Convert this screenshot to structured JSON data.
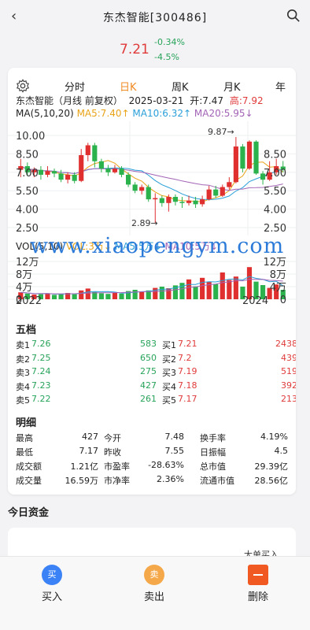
{
  "header": {
    "title": "东杰智能[300486]",
    "back_icon": "‹"
  },
  "quote": {
    "price": "7.21",
    "change": "-0.34%",
    "change_pct": "-4.5%"
  },
  "chart": {
    "tabs": [
      "分时",
      "日K",
      "周K",
      "月K",
      "年"
    ],
    "active_tab": "日K",
    "info": {
      "name": "东杰智能（月线 前复权）",
      "date": "2025-03-21",
      "open": "开:7.47",
      "high": "高:7.92"
    },
    "ma_legend": {
      "prefix": "MA(5,10,20)",
      "ma5": "MA5:7.40↑",
      "ma10": "MA10:6.32↑",
      "ma20": "MA20:5.95↓"
    },
    "vol_legend": {
      "prefix": "VOL(5,10)",
      "vol": "VOL:3万↓",
      "ma5": "MA5:5万↓",
      "ma10": "MA10:5万↓"
    },
    "price_ticks": [
      "10.00",
      "8.50",
      "7.00",
      "5.50",
      "4.00",
      "2.50"
    ],
    "price_ticks_right": [
      "8.50",
      "7.00",
      "5.50",
      "4.00",
      "2.50"
    ],
    "high_label": "9.87→",
    "low_label": "2.89→",
    "vol_ticks": [
      "12万",
      "8万",
      "4万",
      "0"
    ],
    "vol_ticks_right": [
      "12万",
      "8万",
      "4万",
      "0"
    ],
    "x_labels": [
      "2022",
      "2024"
    ]
  },
  "chart_data": {
    "type": "candlestick",
    "period": "month",
    "candles": [
      {
        "o": 7.2,
        "c": 7.5,
        "h": 8.1,
        "l": 6.6
      },
      {
        "o": 7.5,
        "c": 7.0,
        "h": 7.8,
        "l": 6.7
      },
      {
        "o": 7.0,
        "c": 7.2,
        "h": 7.4,
        "l": 6.6
      },
      {
        "o": 7.2,
        "c": 6.8,
        "h": 7.5,
        "l": 6.4
      },
      {
        "o": 6.8,
        "c": 7.1,
        "h": 7.5,
        "l": 6.6
      },
      {
        "o": 7.1,
        "c": 6.9,
        "h": 7.3,
        "l": 6.6
      },
      {
        "o": 6.9,
        "c": 6.4,
        "h": 7.2,
        "l": 6.2
      },
      {
        "o": 6.4,
        "c": 6.8,
        "h": 7.0,
        "l": 6.1
      },
      {
        "o": 6.8,
        "c": 6.3,
        "h": 7.0,
        "l": 6.1
      },
      {
        "o": 6.3,
        "c": 8.4,
        "h": 8.9,
        "l": 6.2
      },
      {
        "o": 8.4,
        "c": 9.2,
        "h": 9.4,
        "l": 7.9
      },
      {
        "o": 9.2,
        "c": 7.9,
        "h": 9.4,
        "l": 7.4
      },
      {
        "o": 7.9,
        "c": 7.3,
        "h": 8.1,
        "l": 7.0
      },
      {
        "o": 7.3,
        "c": 7.0,
        "h": 7.6,
        "l": 6.7
      },
      {
        "o": 7.0,
        "c": 7.3,
        "h": 7.6,
        "l": 6.9
      },
      {
        "o": 7.3,
        "c": 6.8,
        "h": 7.5,
        "l": 6.6
      },
      {
        "o": 6.8,
        "c": 6.0,
        "h": 7.0,
        "l": 5.8
      },
      {
        "o": 6.0,
        "c": 5.5,
        "h": 6.2,
        "l": 5.3
      },
      {
        "o": 5.5,
        "c": 5.8,
        "h": 6.0,
        "l": 5.2
      },
      {
        "o": 5.8,
        "c": 4.8,
        "h": 6.0,
        "l": 4.6
      },
      {
        "o": 4.8,
        "c": 4.9,
        "h": 5.3,
        "l": 2.89
      },
      {
        "o": 4.9,
        "c": 4.5,
        "h": 5.1,
        "l": 4.2
      },
      {
        "o": 4.5,
        "c": 5.0,
        "h": 5.2,
        "l": 3.8
      },
      {
        "o": 5.0,
        "c": 4.6,
        "h": 5.2,
        "l": 4.3
      },
      {
        "o": 4.6,
        "c": 4.5,
        "h": 5.0,
        "l": 4.1
      },
      {
        "o": 4.5,
        "c": 4.7,
        "h": 5.1,
        "l": 4.3
      },
      {
        "o": 4.7,
        "c": 4.4,
        "h": 5.0,
        "l": 4.1
      },
      {
        "o": 4.4,
        "c": 4.8,
        "h": 5.1,
        "l": 4.2
      },
      {
        "o": 4.8,
        "c": 5.6,
        "h": 5.9,
        "l": 4.7
      },
      {
        "o": 5.6,
        "c": 5.1,
        "h": 5.9,
        "l": 4.9
      },
      {
        "o": 5.1,
        "c": 5.8,
        "h": 6.0,
        "l": 5.0
      },
      {
        "o": 5.8,
        "c": 6.2,
        "h": 6.6,
        "l": 5.6
      },
      {
        "o": 6.2,
        "c": 9.1,
        "h": 9.87,
        "l": 6.1
      },
      {
        "o": 9.1,
        "c": 7.3,
        "h": 9.3,
        "l": 7.0
      },
      {
        "o": 7.3,
        "c": 9.5,
        "h": 9.6,
        "l": 7.2
      },
      {
        "o": 9.5,
        "c": 6.9,
        "h": 9.6,
        "l": 6.8
      },
      {
        "o": 6.9,
        "c": 6.4,
        "h": 7.1,
        "l": 6.0
      },
      {
        "o": 6.4,
        "c": 7.0,
        "h": 7.9,
        "l": 6.3
      },
      {
        "o": 7.0,
        "c": 7.5,
        "h": 8.1,
        "l": 6.8
      },
      {
        "o": 7.47,
        "c": 7.21,
        "h": 7.92,
        "l": 7.0
      }
    ],
    "volume": [
      2.2,
      1.8,
      1.5,
      1.6,
      1.9,
      1.4,
      1.7,
      2.0,
      1.6,
      2.8,
      3.4,
      2.3,
      1.9,
      1.7,
      2.1,
      1.8,
      2.6,
      3.0,
      2.4,
      2.8,
      3.6,
      4.0,
      3.5,
      4.4,
      5.2,
      6.3,
      4.1,
      6.8,
      5.5,
      4.8,
      8.5,
      6.1,
      7.2,
      4.0,
      10.2,
      5.6,
      4.5,
      3.6,
      4.7,
      3.0
    ],
    "ylim": [
      2.5,
      10.0
    ],
    "vol_max": 12
  },
  "orderbook": {
    "title": "五档",
    "sell": [
      {
        "label": "卖1",
        "price": "7.26",
        "vol": "583"
      },
      {
        "label": "卖2",
        "price": "7.25",
        "vol": "650"
      },
      {
        "label": "卖3",
        "price": "7.24",
        "vol": "275"
      },
      {
        "label": "卖4",
        "price": "7.23",
        "vol": "427"
      },
      {
        "label": "卖5",
        "price": "7.22",
        "vol": "261"
      }
    ],
    "buy": [
      {
        "label": "买1",
        "price": "7.21",
        "vol": "2438"
      },
      {
        "label": "买2",
        "price": "7.2",
        "vol": "439"
      },
      {
        "label": "买3",
        "price": "7.19",
        "vol": "519"
      },
      {
        "label": "买4",
        "price": "7.18",
        "vol": "392"
      },
      {
        "label": "买5",
        "price": "7.17",
        "vol": "213"
      }
    ]
  },
  "details": {
    "title": "明细",
    "rows": [
      [
        {
          "k": "最高",
          "v": "427"
        },
        {
          "k": "今开",
          "v": "7.48"
        },
        {
          "k": "换手率",
          "v": "4.19%"
        }
      ],
      [
        {
          "k": "最低",
          "v": "7.17"
        },
        {
          "k": "昨收",
          "v": "7.55"
        },
        {
          "k": "日振幅",
          "v": "4.5"
        }
      ],
      [
        {
          "k": "成交额",
          "v": "1.21亿"
        },
        {
          "k": "市盈率",
          "v": "-28.63%"
        },
        {
          "k": "总市值",
          "v": "29.39亿"
        }
      ],
      [
        {
          "k": "成交量",
          "v": "16.59万"
        },
        {
          "k": "市净率",
          "v": "2.36%"
        },
        {
          "k": "流通市值",
          "v": "28.56亿"
        }
      ]
    ]
  },
  "capital": {
    "title": "今日资金",
    "tip": "大单买入"
  },
  "watermark": "www.xiaopengym.com",
  "bottom": {
    "buy_label": "买入",
    "buy_icon": "买",
    "sell_label": "卖出",
    "sell_icon": "卖",
    "delete_label": "删除",
    "colors": {
      "buy": "#3b82f6",
      "sell": "#f5a84a",
      "delete": "#f05a22"
    }
  }
}
